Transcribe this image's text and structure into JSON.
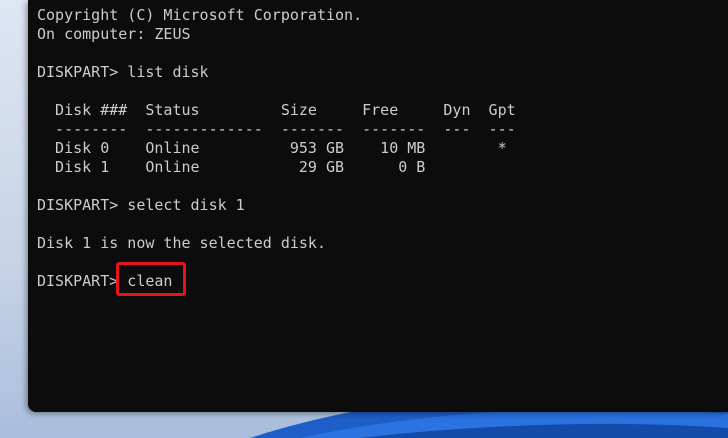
{
  "terminal": {
    "lines": [
      "Copyright (C) Microsoft Corporation.",
      "On computer: ZEUS",
      "",
      "DISKPART> list disk",
      "",
      "  Disk ###  Status         Size     Free     Dyn  Gpt",
      "  --------  -------------  -------  -------  ---  ---",
      "  Disk 0    Online          953 GB    10 MB        *",
      "  Disk 1    Online           29 GB      0 B",
      "",
      "DISKPART> select disk 1",
      "",
      "Disk 1 is now the selected disk.",
      "",
      "DISKPART> clean"
    ]
  },
  "colors": {
    "terminal_background": "#0c0c0c",
    "terminal_text": "#cccccc",
    "highlight_border": "#e3141a"
  }
}
